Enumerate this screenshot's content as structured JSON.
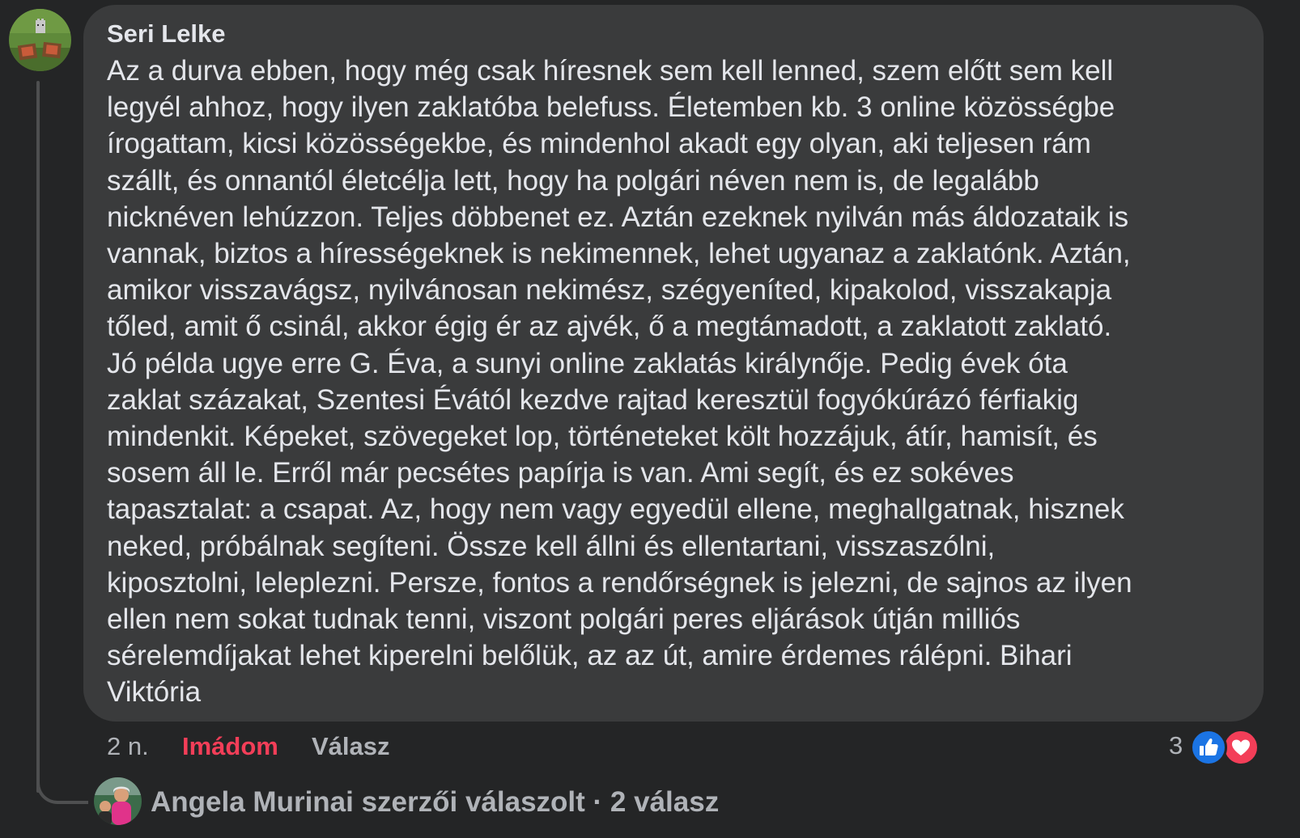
{
  "comment": {
    "author": "Seri Lelke",
    "avatar_icon": "avatar-image",
    "lines": [
      "Az a durva ebben, hogy még csak híresnek sem kell lenned, szem előtt sem kell",
      "legyél ahhoz, hogy ilyen zaklatóba belefuss. Életemben kb. 3 online közösségbe",
      "írogattam, kicsi közösségekbe, és mindenhol akadt egy olyan, aki teljesen rám",
      "szállt, és onnantól életcélja lett, hogy ha polgári néven nem is, de legalább",
      "nicknéven lehúzzon. Teljes döbbenet ez. Aztán ezeknek nyilván más áldozataik is",
      "vannak, biztos a hírességeknek is nekimennek, lehet ugyanaz a zaklatónk. Aztán,",
      "amikor visszavágsz, nyilvánosan nekimész, szégyeníted, kipakolod, visszakapja",
      "tőled, amit ő csinál, akkor égig ér az ajvék, ő a megtámadott, a zaklatott zaklató.",
      "Jó példa ugye erre G. Éva, a sunyi online zaklatás királynője. Pedig évek óta",
      "zaklat százakat, Szentesi Évától kezdve rajtad keresztül fogyókúrázó férfiakig",
      "mindenkit. Képeket, szövegeket lop, történeteket költ hozzájuk, átír, hamisít, és",
      "sosem áll le. Erről már pecsétes papírja is van. Ami segít, és ez sokéves",
      "tapasztalat: a csapat. Az, hogy nem vagy egyedül ellene, meghallgatnak, hisznek",
      "neked, próbálnak segíteni. Össze kell állni és ellentartani, visszaszólni,",
      "kiposztolni, leleplezni. Persze, fontos a rendőrségnek is jelezni, de sajnos az ilyen",
      "ellen nem sokat tudnak tenni, viszont polgári peres eljárások útján milliós",
      "sérelemdíjakat lehet kiperelni belőlük, az az út, amire érdemes rálépni. Bihari",
      "Viktória"
    ]
  },
  "actions": {
    "time": "2 n.",
    "love_label": "Imádom",
    "reply_label": "Válasz"
  },
  "reactions": {
    "count": "3",
    "icons": [
      "like-icon",
      "love-icon"
    ],
    "colors": {
      "like": "#1b74e4",
      "love": "#f33e58",
      "love_text": "#f33e58"
    }
  },
  "replies": {
    "avatar_icon": "avatar-image",
    "label": "Angela Murinai szerzői válaszolt · 2 válasz"
  }
}
